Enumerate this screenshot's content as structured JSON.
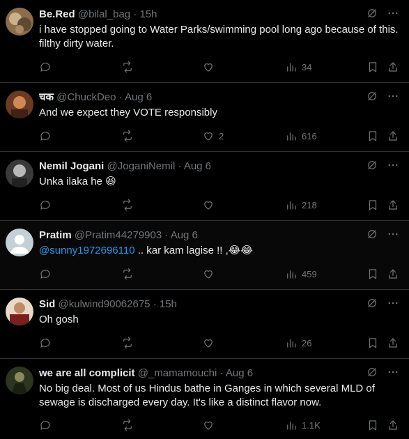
{
  "tweets": [
    {
      "name": "Be.Red",
      "handle": "@bilal_bag",
      "dot": "·",
      "time": "15h",
      "text": "i have stopped going to Water Parks/swimming pool long ago because of this. filthy dirty water.",
      "likes": "",
      "views": "34",
      "avatar_color": "#8a6d4b",
      "avatar_color2": "#c9b28a"
    },
    {
      "name": "चक",
      "handle": "@ChuckDeo",
      "dot": "·",
      "time": "Aug 6",
      "text": "And we expect they VOTE responsibly",
      "likes": "2",
      "views": "616",
      "avatar_color": "#6b3a22",
      "avatar_color2": "#d08a55"
    },
    {
      "name": "Nemil Jogani",
      "handle": "@JoganiNemil",
      "dot": "·",
      "time": "Aug 6",
      "text": "Unka ilaka he",
      "emoji": "😆",
      "likes": "",
      "views": "218",
      "avatar_color": "#3a3a3a",
      "avatar_color2": "#b9b9b9"
    },
    {
      "name": "Pratim",
      "handle": "@Pratim44279903",
      "dot": "·",
      "time": "Aug 6",
      "mention": "@sunny1972696110",
      "text": " .. kar kam lagise !! ,",
      "emoji": "😂😂",
      "likes": "",
      "views": "459",
      "avatar_color": "#c4cfd6",
      "avatar_color2": "#ffffff"
    },
    {
      "name": "Sid",
      "handle": "@kulwind90062675",
      "dot": "·",
      "time": "15h",
      "text": "Oh gosh",
      "likes": "",
      "views": "26",
      "avatar_color": "#7a1e1e",
      "avatar_color2": "#e8d9c8"
    },
    {
      "name": "we are all complicit",
      "handle": "@_mamamouchi",
      "dot": "·",
      "time": "Aug 6",
      "text": "No big deal. Most of us Hindus bathe in Ganges in which several MLD of sewage is discharged every day. It's like a distinct flavor  now.",
      "likes": "",
      "views": "1.1K",
      "avatar_color": "#2d3520",
      "avatar_color2": "#8c8a5a"
    }
  ]
}
